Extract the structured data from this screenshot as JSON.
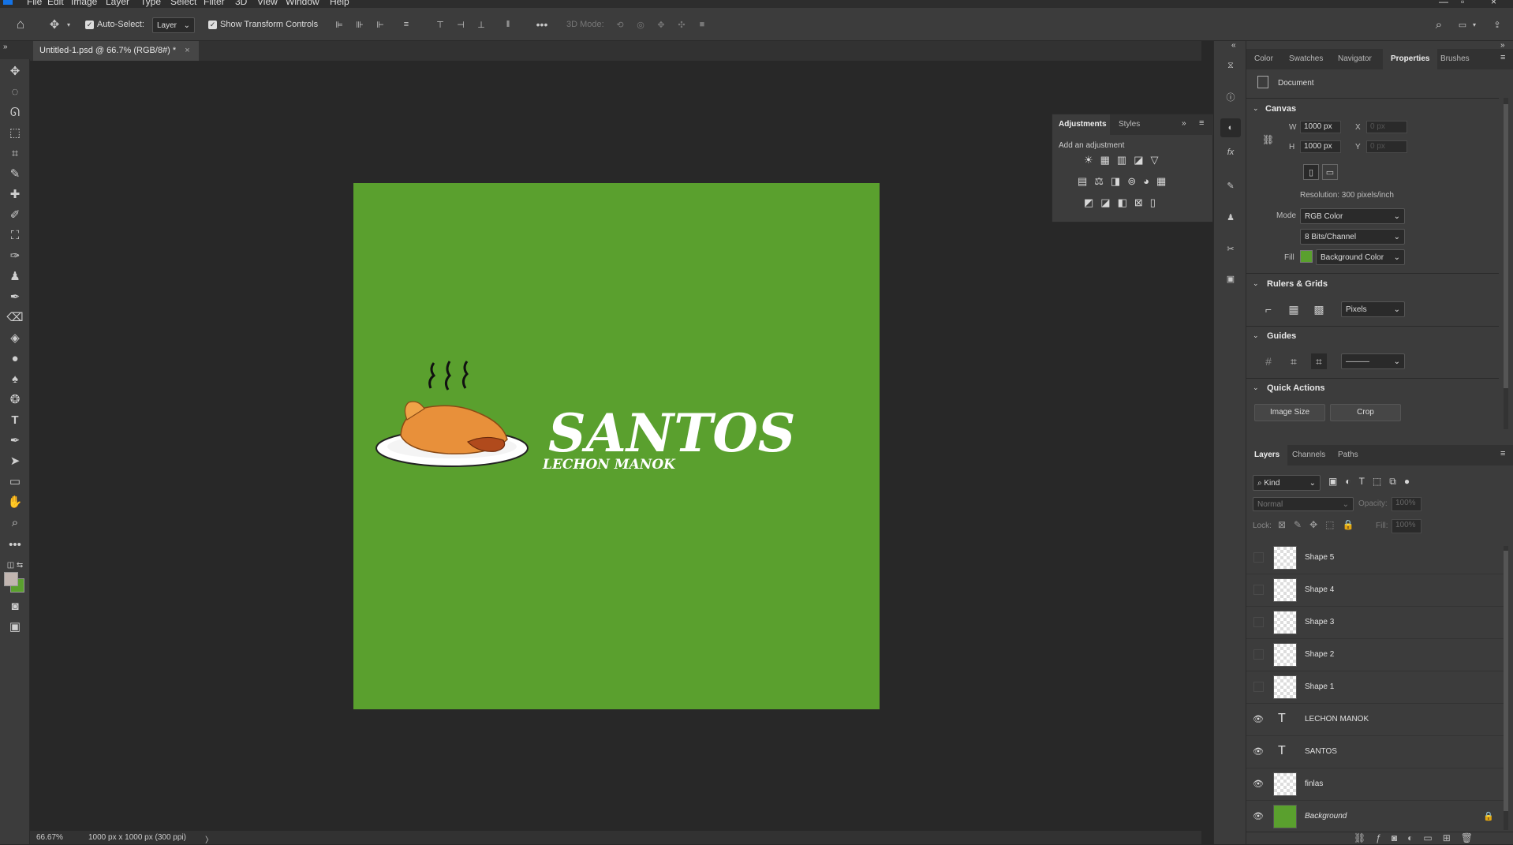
{
  "menubar": {
    "items": [
      "File",
      "Edit",
      "Image",
      "Layer",
      "Type",
      "Select",
      "Filter",
      "3D",
      "View",
      "Window",
      "Help"
    ]
  },
  "options_bar": {
    "auto_select_label": "Auto-Select:",
    "auto_select_target": "Layer",
    "show_transform_label": "Show Transform Controls",
    "mode_3d_label": "3D Mode:"
  },
  "document": {
    "tab_title": "Untitled-1.psd @ 66.7% (RGB/8#) *",
    "tab_close": "×",
    "background_color": "#5aa02e",
    "logo_title": "SANTOS",
    "logo_subtitle": "LECHON MANOK"
  },
  "status": {
    "zoom": "66.67%",
    "info": "1000 px x 1000 px (300 ppi)",
    "arrow": "〉"
  },
  "adjustments": {
    "tabs": [
      "Adjustments",
      "Styles"
    ],
    "hint": "Add an adjustment"
  },
  "properties": {
    "tabs": [
      "Color",
      "Swatches",
      "Navigator",
      "Properties",
      "Brushes"
    ],
    "active_tab": "Properties",
    "doc_label": "Document",
    "canvas_section": "Canvas",
    "w_label": "W",
    "w_value": "1000 px",
    "h_label": "H",
    "h_value": "1000 px",
    "x_label": "X",
    "x_placeholder": "0 px",
    "y_label": "Y",
    "y_placeholder": "0 px",
    "resolution": "Resolution: 300 pixels/inch",
    "mode_label": "Mode",
    "mode_value": "RGB Color",
    "bits_value": "8 Bits/Channel",
    "fill_label": "Fill",
    "fill_value": "Background Color",
    "fill_swatch": "#5aa02e",
    "rulers_section": "Rulers & Grids",
    "units_value": "Pixels",
    "guides_section": "Guides",
    "quick_actions_section": "Quick Actions",
    "image_size_button": "Image Size",
    "crop_button": "Crop"
  },
  "layers_panel": {
    "tabs": [
      "Layers",
      "Channels",
      "Paths"
    ],
    "kind_label": "Kind",
    "blend_mode": "Normal",
    "opacity_label": "Opacity:",
    "opacity_value": "100%",
    "lock_label": "Lock:",
    "fill_label": "Fill:",
    "fill_value": "100%",
    "layers": [
      {
        "name": "Shape 5",
        "visible": false,
        "type": "shape"
      },
      {
        "name": "Shape 4",
        "visible": false,
        "type": "shape"
      },
      {
        "name": "Shape 3",
        "visible": false,
        "type": "shape"
      },
      {
        "name": "Shape 2",
        "visible": false,
        "type": "shape"
      },
      {
        "name": "Shape 1",
        "visible": false,
        "type": "shape"
      },
      {
        "name": "LECHON MANOK",
        "visible": true,
        "type": "text"
      },
      {
        "name": "SANTOS",
        "visible": true,
        "type": "text"
      },
      {
        "name": "finlas",
        "visible": true,
        "type": "smart"
      },
      {
        "name": "Background",
        "visible": true,
        "type": "background"
      }
    ]
  }
}
